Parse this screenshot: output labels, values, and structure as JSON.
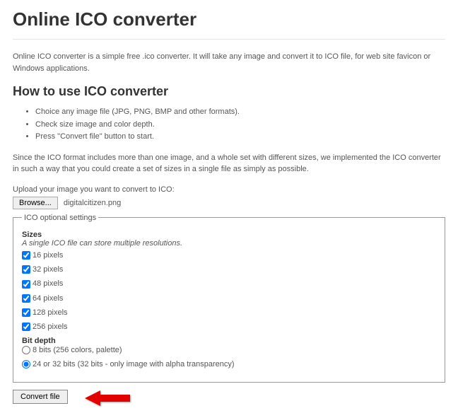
{
  "page": {
    "title": "Online ICO converter",
    "intro": "Online ICO converter is a simple free .ico converter. It will take any image and convert it to ICO file, for web site favicon or Windows applications.",
    "howto_heading": "How to use ICO converter",
    "howto_items": [
      "Choice any image file (JPG, PNG, BMP and other formats).",
      "Check size image and color depth.",
      "Press \"Convert file\" button to start."
    ],
    "format_note": "Since the ICO format includes more than one image, and a whole set with different sizes, we implemented the ICO converter in such a way that you could create a set of sizes in a single file as simply as possible.",
    "upload_label": "Upload your image you want to convert to ICO:",
    "browse_label": "Browse...",
    "selected_file": "digitalcitizen.png",
    "fieldset_legend": "ICO optional settings",
    "sizes_label": "Sizes",
    "sizes_hint": "A single ICO file can store multiple resolutions.",
    "sizes": [
      {
        "label": "16 pixels",
        "checked": true
      },
      {
        "label": "32 pixels",
        "checked": true
      },
      {
        "label": "48 pixels",
        "checked": true
      },
      {
        "label": "64 pixels",
        "checked": true
      },
      {
        "label": "128 pixels",
        "checked": true
      },
      {
        "label": "256 pixels",
        "checked": true
      }
    ],
    "bitdepth_label": "Bit depth",
    "bitdepth_options": [
      {
        "label": "8 bits (256 colors, palette)",
        "checked": false
      },
      {
        "label": "24 or 32 bits (32 bits - only image with alpha transparency)",
        "checked": true
      }
    ],
    "convert_label": "Convert file"
  }
}
